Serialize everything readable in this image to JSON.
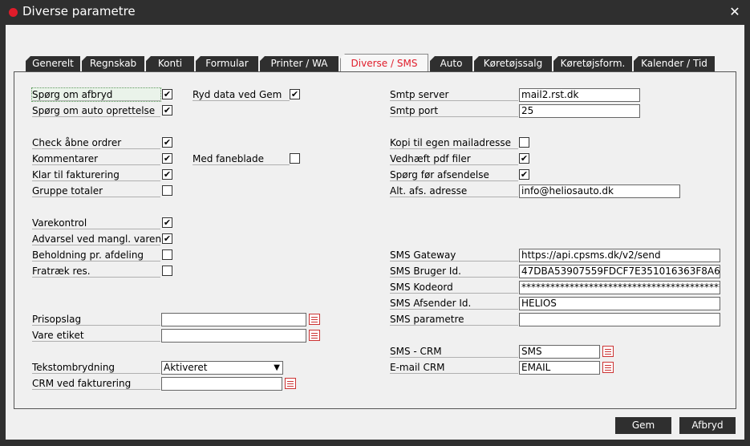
{
  "window": {
    "title": "Diverse parametre"
  },
  "tabs": [
    "Generelt",
    "Regnskab",
    "Konti",
    "Formular",
    "Printer / WA",
    "Diverse / SMS",
    "Auto",
    "Køretøjssalg",
    "Køretøjsform.",
    "Kalender / Tid"
  ],
  "active_tab": "Diverse / SMS",
  "left": {
    "spoerg_afbryd": {
      "label": "Spørg om afbryd",
      "checked": true
    },
    "spoerg_auto": {
      "label": "Spørg om auto oprettelse",
      "checked": true
    },
    "check_aabne": {
      "label": "Check åbne ordrer",
      "checked": true
    },
    "kommentarer": {
      "label": "Kommentarer",
      "checked": true
    },
    "klar_fakt": {
      "label": "Klar til fakturering",
      "checked": true
    },
    "gruppe": {
      "label": "Gruppe totaler",
      "checked": false
    },
    "varekontrol": {
      "label": "Varekontrol",
      "checked": true
    },
    "advarsel": {
      "label": "Advarsel ved mangl. varenr.",
      "checked": true
    },
    "beholdning": {
      "label": "Beholdning pr. afdeling",
      "checked": false
    },
    "fratraek": {
      "label": "Fratræk res.",
      "checked": false
    },
    "prisopslag": {
      "label": "Prisopslag",
      "value": ""
    },
    "vare_etiket": {
      "label": "Vare etiket",
      "value": ""
    },
    "tekstombrydning": {
      "label": "Tekstombrydning",
      "value": "Aktiveret"
    },
    "crm_fakt": {
      "label": "CRM ved fakturering",
      "value": ""
    }
  },
  "middle": {
    "ryd_data": {
      "label": "Ryd data ved Gem",
      "checked": true
    },
    "med_faneblade": {
      "label": "Med faneblade",
      "checked": false
    }
  },
  "right": {
    "smtp_server": {
      "label": "Smtp server",
      "value": "mail2.rst.dk"
    },
    "smtp_port": {
      "label": "Smtp port",
      "value": "25"
    },
    "kopi": {
      "label": "Kopi til egen mailadresse",
      "checked": false
    },
    "vedhaeft": {
      "label": "Vedhæft pdf filer",
      "checked": true
    },
    "spoerg_afs": {
      "label": "Spørg før afsendelse",
      "checked": true
    },
    "alt_afs": {
      "label": "Alt. afs. adresse",
      "value": "info@heliosauto.dk"
    },
    "sms_gateway": {
      "label": "SMS Gateway",
      "value": "https://api.cpsms.dk/v2/send"
    },
    "sms_bruger": {
      "label": "SMS Bruger Id.",
      "value": "47DBA53907559FDCF7E351016363F8A6"
    },
    "sms_kode": {
      "label": "SMS Kodeord",
      "value": "************************************************"
    },
    "sms_afsender": {
      "label": "SMS Afsender Id.",
      "value": "HELIOS"
    },
    "sms_param": {
      "label": "SMS parametre",
      "value": ""
    },
    "sms_crm": {
      "label": "SMS - CRM",
      "value": "SMS"
    },
    "email_crm": {
      "label": "E-mail CRM",
      "value": "EMAIL"
    }
  },
  "buttons": {
    "gem": "Gem",
    "afbryd": "Afbryd"
  }
}
